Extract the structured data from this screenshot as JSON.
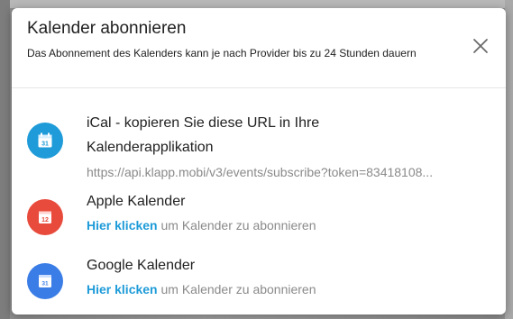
{
  "dialog": {
    "title": "Kalender abonnieren",
    "subtitle": "Das Abonnement des Kalenders kann je nach Provider bis zu 24 Stunden dauern",
    "close_icon": "close-icon"
  },
  "items": [
    {
      "title_line1": "iCal - kopieren Sie diese URL in Ihre",
      "title_line2": "Kalenderapplikation",
      "url": "https://api.klapp.mobi/v3/events/subscribe?token=83418108...",
      "icon": "calendar-31-icon",
      "color": "#1e9bd8",
      "icon_number": "31"
    },
    {
      "title": "Apple Kalender",
      "link": "Hier klicken",
      "rest": " um Kalender zu abonnieren",
      "icon": "calendar-12-icon",
      "color": "#e84b3c",
      "icon_number": "12"
    },
    {
      "title": "Google Kalender",
      "link": "Hier klicken",
      "rest": " um Kalender zu abonnieren",
      "icon": "google-calendar-icon",
      "color": "#3b7de6",
      "icon_number": "31"
    }
  ]
}
